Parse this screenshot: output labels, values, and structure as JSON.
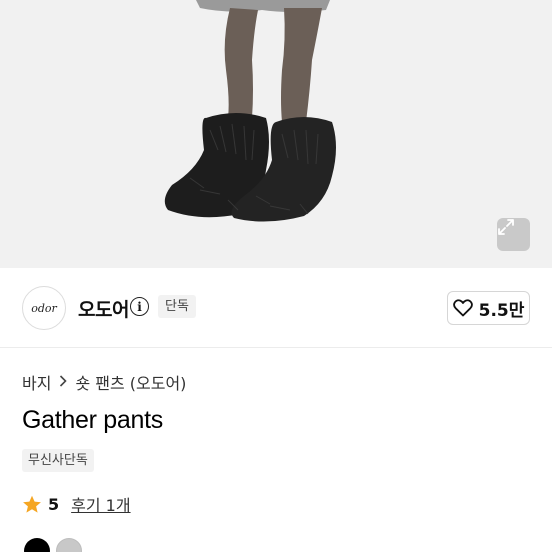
{
  "hero": {
    "expand_icon": "expand-icon"
  },
  "brand": {
    "logo_text": "odor",
    "name": "오도어",
    "info_icon": "info-icon",
    "exclusive_label": "단독",
    "like_icon": "heart-icon",
    "like_count": "5.5만"
  },
  "breadcrumb": {
    "items": [
      "바지",
      "숏 팬츠 (오도어)"
    ],
    "separator_icon": "chevron-right-icon"
  },
  "product": {
    "title": "Gather pants",
    "tag": "무신사단독",
    "rating_icon": "star-icon",
    "rating": "5",
    "review_label": "후기 1개"
  },
  "colors": {
    "accent_star": "#f5a623",
    "swatches": [
      "#000000",
      "#c8c8c8"
    ]
  }
}
